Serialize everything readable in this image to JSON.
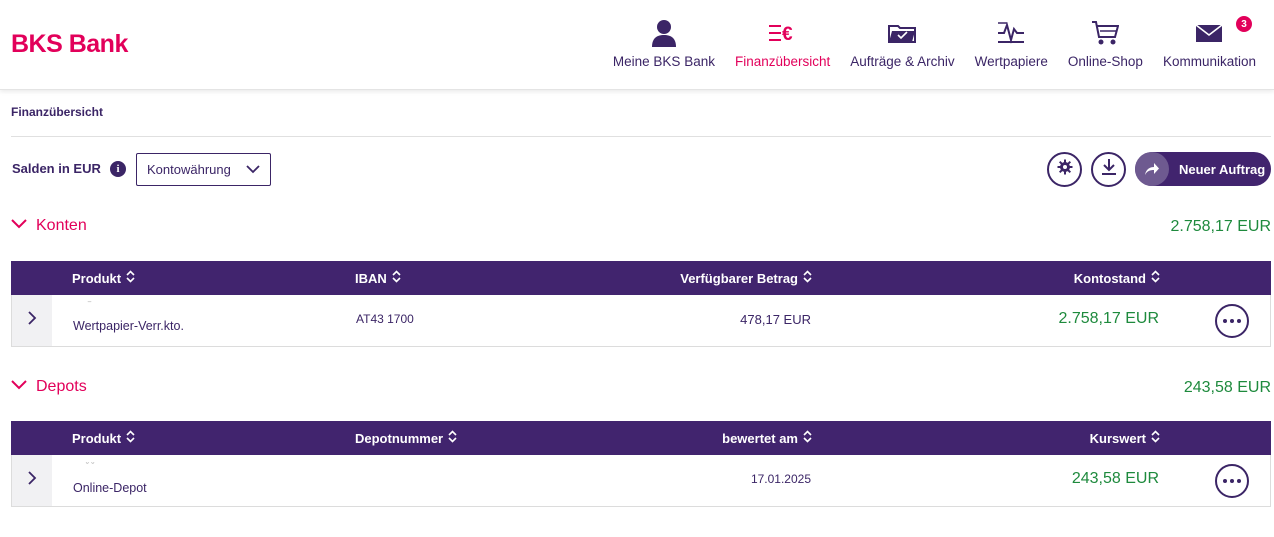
{
  "brand": {
    "name": "BKS Bank"
  },
  "nav": [
    {
      "label": "Meine BKS Bank",
      "icon": "user-icon"
    },
    {
      "label": "Finanzübersicht",
      "icon": "list-euro-icon",
      "active": true
    },
    {
      "label": "Aufträge & Archiv",
      "icon": "folder-icon"
    },
    {
      "label": "Wertpapiere",
      "icon": "chart-icon"
    },
    {
      "label": "Online-Shop",
      "icon": "cart-icon"
    },
    {
      "label": "Kommunikation",
      "icon": "mail-icon",
      "badge": "3"
    }
  ],
  "breadcrumb": "Finanzübersicht",
  "controls": {
    "salden_label": "Salden in EUR",
    "info_glyph": "i",
    "currency_select": "Kontowährung",
    "new_order_label": "Neuer Auftrag"
  },
  "konten": {
    "title": "Konten",
    "total": "2.758,17 EUR",
    "columns": [
      "Produkt",
      "IBAN",
      "Verfügbarer Betrag",
      "Kontostand"
    ],
    "rows": [
      {
        "product": "Wertpapier-Verr.kto.",
        "iban": "AT43 1700",
        "available": "478,17 EUR",
        "balance": "2.758,17 EUR"
      }
    ]
  },
  "depots": {
    "title": "Depots",
    "total": "243,58 EUR",
    "columns": [
      "Produkt",
      "Depotnummer",
      "bewertet am",
      "Kurswert"
    ],
    "rows": [
      {
        "product": "Online-Depot",
        "number": "",
        "valued_on": "17.01.2025",
        "value": "243,58 EUR"
      }
    ]
  },
  "colors": {
    "brand_pink": "#e2005a",
    "brand_purple": "#41246e",
    "positive_green": "#1e8a3d"
  }
}
